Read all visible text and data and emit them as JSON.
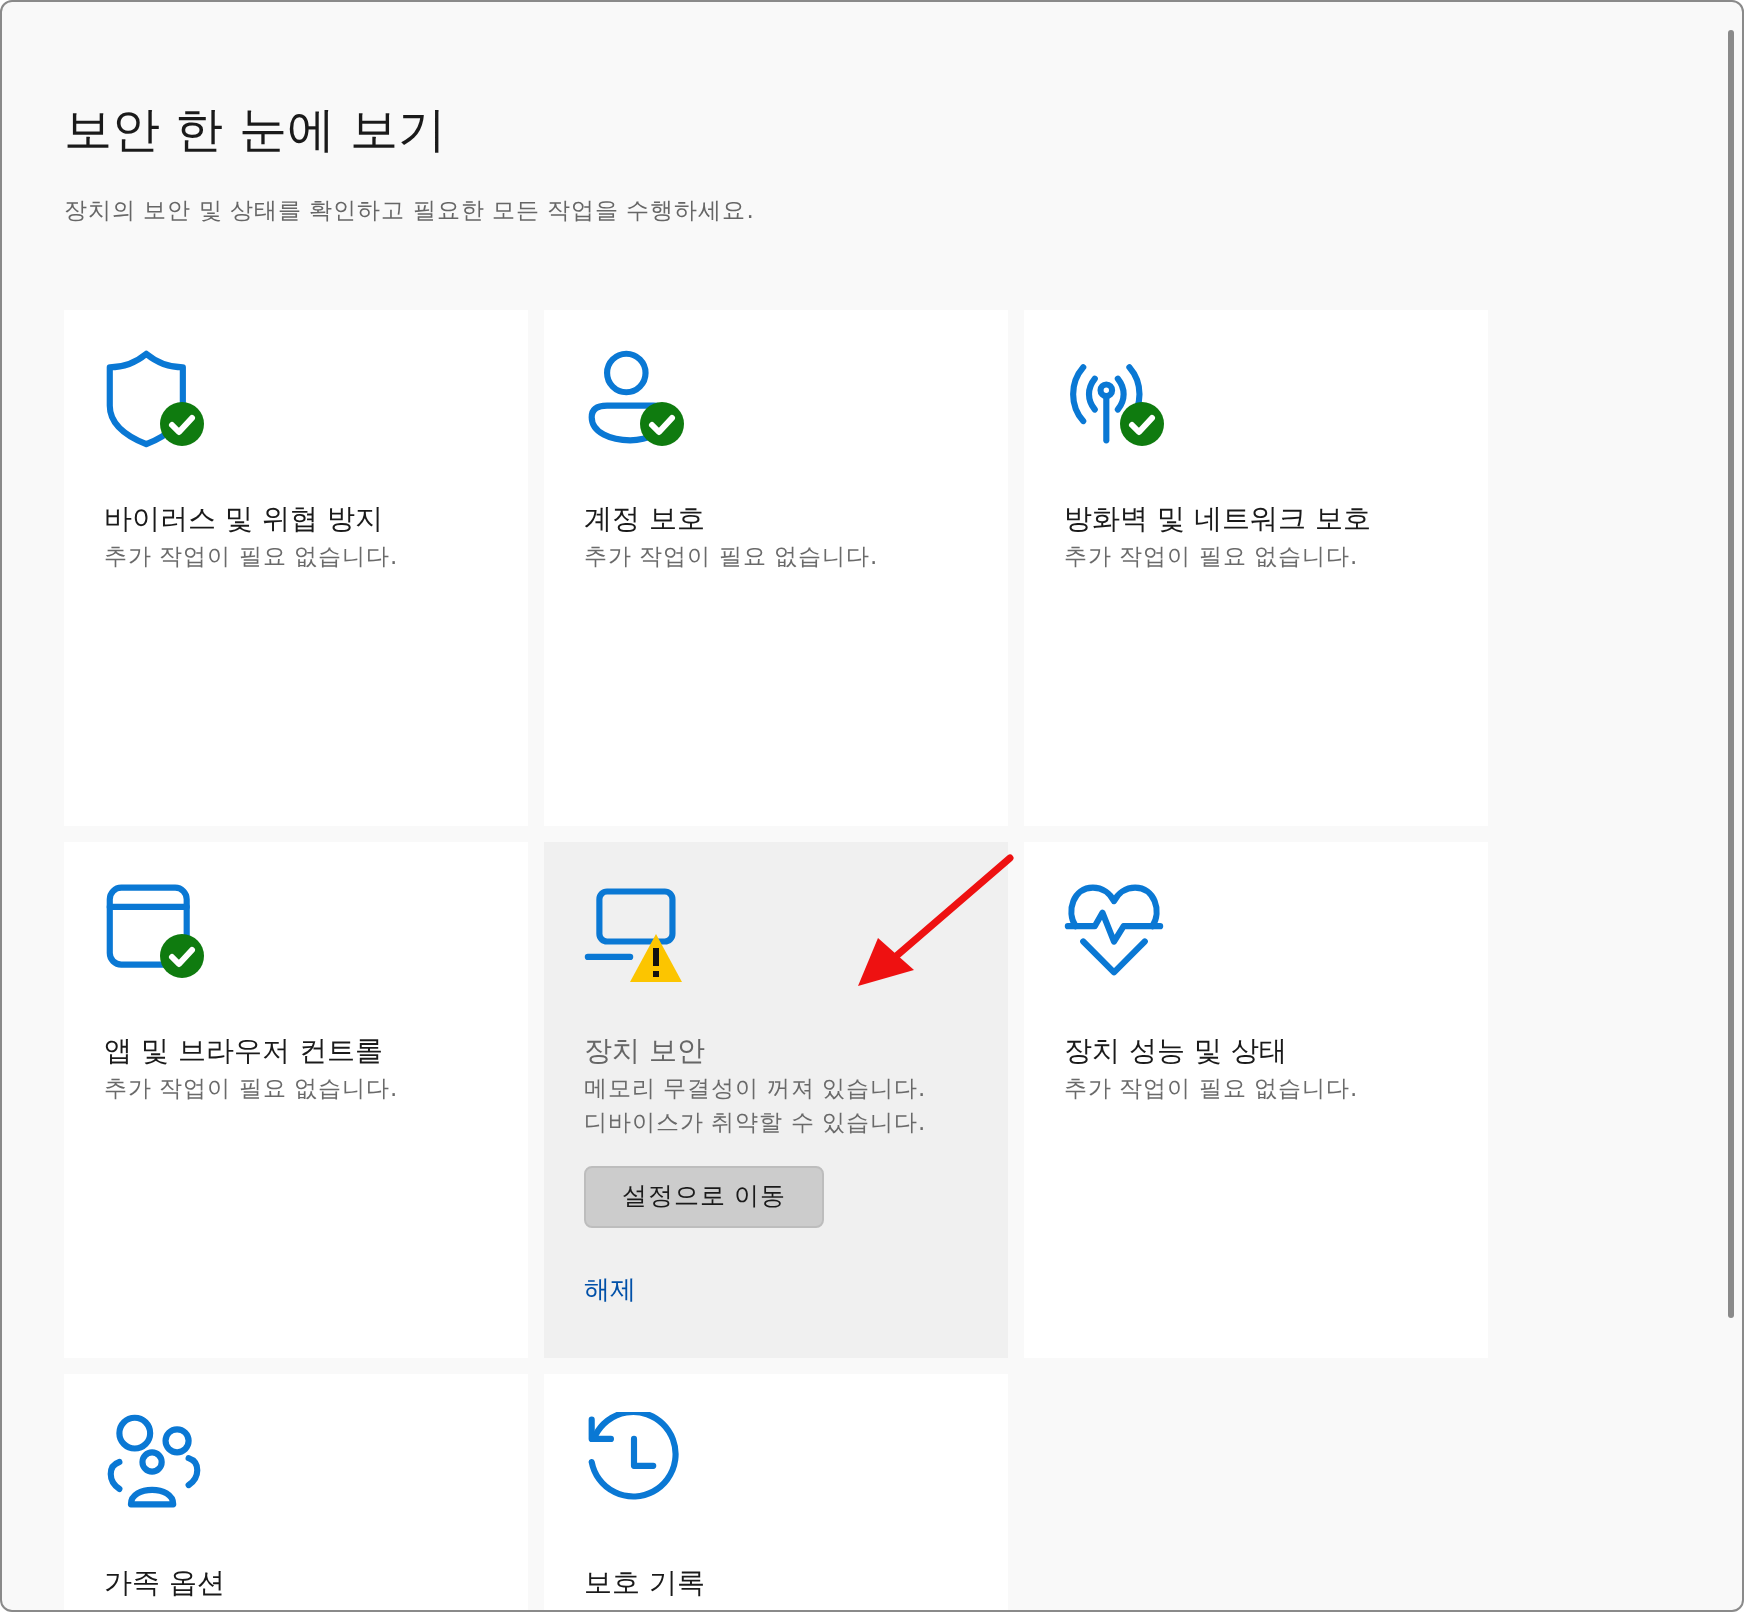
{
  "page": {
    "title": "보안 한 눈에 보기",
    "subtitle": "장치의 보안 및 상태를 확인하고 필요한 모든 작업을 수행하세요."
  },
  "cards": [
    {
      "title": "바이러스 및 위협 방지",
      "kind": "ok",
      "selected": false,
      "lines": [
        "추가 작업이 필요 없습니다."
      ]
    },
    {
      "title": "계정 보호",
      "kind": "ok",
      "selected": false,
      "lines": [
        "추가 작업이 필요 없습니다."
      ]
    },
    {
      "title": "방화벽 및 네트워크 보호",
      "kind": "ok",
      "selected": false,
      "lines": [
        "추가 작업이 필요 없습니다."
      ]
    },
    {
      "title": "앱 및 브라우저 컨트롤",
      "kind": "ok",
      "selected": false,
      "lines": [
        "추가 작업이 필요 없습니다."
      ]
    },
    {
      "title": "장치 보안",
      "kind": "warning",
      "selected": true,
      "lines": [
        "메모리 무결성이 꺼져 있습니다.",
        "디바이스가 취약할 수 있습니다."
      ],
      "button": "설정으로 이동",
      "link": "해제"
    },
    {
      "title": "장치 성능 및 상태",
      "kind": "plain",
      "selected": false,
      "lines": [
        "추가 작업이 필요 없습니다."
      ]
    },
    {
      "title": "가족 옵션",
      "kind": "plain",
      "selected": false
    },
    {
      "title": "보호 기록",
      "kind": "plain",
      "selected": false
    }
  ]
}
